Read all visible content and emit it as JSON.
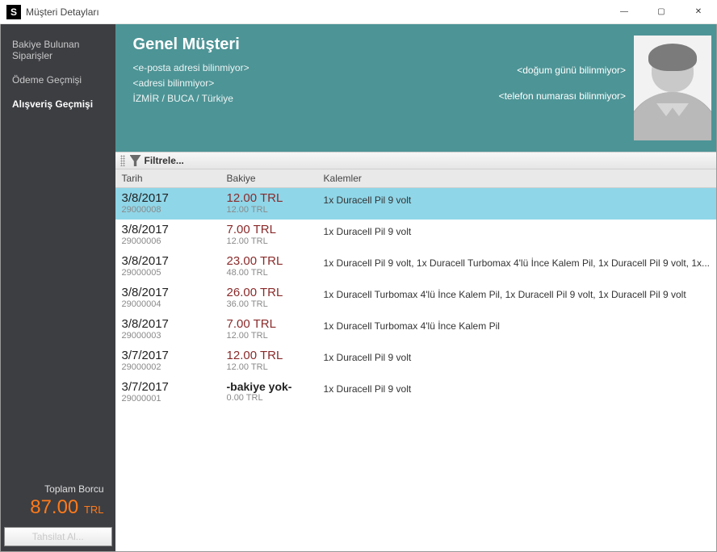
{
  "window": {
    "title": "Müşteri Detayları",
    "logo_letter": "S",
    "minimize": "—",
    "maximize": "▢",
    "close": "✕"
  },
  "sidebar": {
    "items": [
      {
        "label": "Bakiye Bulunan Siparişler",
        "active": false
      },
      {
        "label": "Ödeme Geçmişi",
        "active": false
      },
      {
        "label": "Alışveriş Geçmişi",
        "active": true
      }
    ],
    "total_label": "Toplam Borcu",
    "total_value": "87.00",
    "total_currency": "TRL",
    "tahsilat_button": "Tahsilat Al..."
  },
  "header": {
    "customer_name": "Genel Müşteri",
    "email": "<e-posta adresi bilinmiyor>",
    "address": "<adresi bilinmiyor>",
    "location": "İZMİR / BUCA / Türkiye",
    "birthday": "<doğum günü bilinmiyor>",
    "phone": "<telefon numarası bilinmiyor>"
  },
  "filter": {
    "label": "Filtrele..."
  },
  "columns": {
    "date": "Tarih",
    "balance": "Bakiye",
    "items": "Kalemler"
  },
  "rows": [
    {
      "date": "3/8/2017",
      "order_no": "29000008",
      "balance": "12.00 TRL",
      "total": "12.00 TRL",
      "items": "1x Duracell Pil 9 volt",
      "selected": true
    },
    {
      "date": "3/8/2017",
      "order_no": "29000006",
      "balance": "7.00 TRL",
      "total": "12.00 TRL",
      "items": "1x Duracell Pil 9 volt"
    },
    {
      "date": "3/8/2017",
      "order_no": "29000005",
      "balance": "23.00 TRL",
      "total": "48.00 TRL",
      "items": "1x Duracell Pil 9 volt, 1x Duracell Turbomax 4'lü İnce Kalem Pil, 1x Duracell Pil 9 volt, 1x..."
    },
    {
      "date": "3/8/2017",
      "order_no": "29000004",
      "balance": "26.00 TRL",
      "total": "36.00 TRL",
      "items": "1x Duracell Turbomax 4'lü İnce Kalem Pil, 1x Duracell Pil 9 volt, 1x Duracell Pil 9 volt"
    },
    {
      "date": "3/8/2017",
      "order_no": "29000003",
      "balance": "7.00 TRL",
      "total": "12.00 TRL",
      "items": "1x Duracell Turbomax 4'lü İnce Kalem Pil"
    },
    {
      "date": "3/7/2017",
      "order_no": "29000002",
      "balance": "12.00 TRL",
      "total": "12.00 TRL",
      "items": "1x Duracell Pil 9 volt"
    },
    {
      "date": "3/7/2017",
      "order_no": "29000001",
      "balance": "-bakiye yok-",
      "balance_none": true,
      "total": "0.00 TRL",
      "items": "1x Duracell Pil 9 volt"
    }
  ]
}
